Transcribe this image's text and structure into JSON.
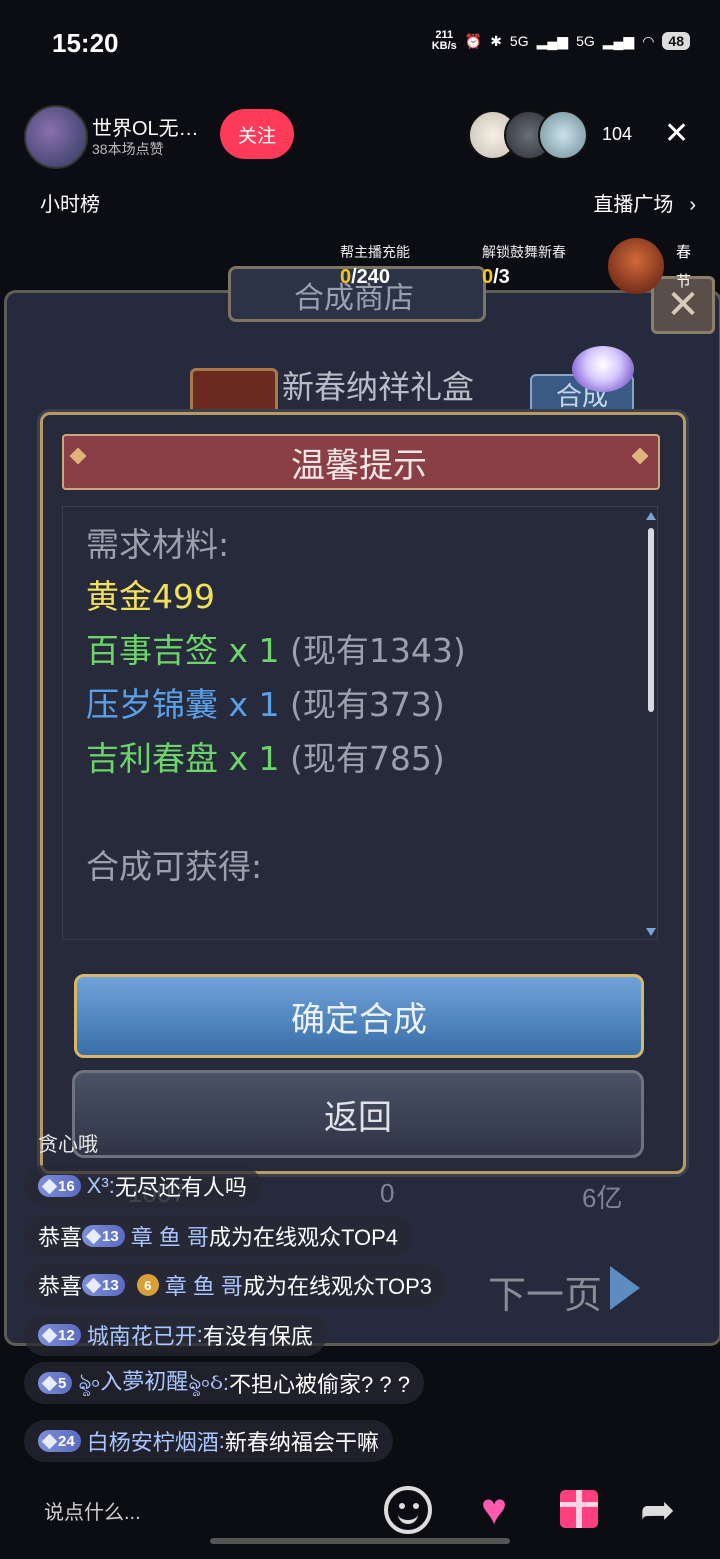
{
  "status_bar": {
    "time": "15:20",
    "net_speed_value": "211",
    "net_speed_unit": "KB/s",
    "signal_1": "5G",
    "signal_2": "5G",
    "battery": "48"
  },
  "header": {
    "host_name": "世界OL无…",
    "host_likes": "38本场点赞",
    "follow_label": "关注",
    "viewer_count": "104",
    "close_symbol": "✕"
  },
  "rank_bar": {
    "hour_rank": "小时榜",
    "live_square": "直播广场"
  },
  "tasks": [
    {
      "label": "帮主播充能",
      "current": "0",
      "total": "/240"
    },
    {
      "label": "解锁鼓舞新春",
      "current": "0",
      "total": "/3"
    }
  ],
  "spring_badge": {
    "line1": "春",
    "line2": "节"
  },
  "game": {
    "shop_title": "合成商店",
    "item_name": "新春纳祥礼盒",
    "synth_button": "合成",
    "next_page": "下一页",
    "bottom_values": [
      "1007",
      "0",
      "6亿"
    ],
    "dialog": {
      "title": "温馨提示",
      "need_label": "需求材料:",
      "materials": [
        {
          "name": "黄金499",
          "qty": "",
          "owned": "",
          "color": "#f0e05a"
        },
        {
          "name": "百事吉签",
          "qty": " x 1 ",
          "owned": "(现有1343)",
          "color": "#6dd46a"
        },
        {
          "name": "压岁锦囊",
          "qty": " x 1 ",
          "owned": "(现有373)",
          "color": "#5aa0e8"
        },
        {
          "name": "吉利春盘",
          "qty": " x 1 ",
          "owned": "(现有785)",
          "color": "#6dd46a"
        }
      ],
      "obtain_label": "合成可获得:",
      "confirm_label": "确定合成",
      "back_label": "返回"
    }
  },
  "chat": {
    "user_only": "贪心哦",
    "messages": [
      {
        "badge": "16",
        "user": "X³",
        "sep": ":",
        "text": "无尽还有人吗"
      },
      {
        "prefix": "恭喜",
        "badge": "13",
        "user": "章 鱼 哥",
        "text": "成为在线观众TOP4"
      },
      {
        "prefix": "恭喜",
        "badge": "13",
        "badge2": "6",
        "user": "章 鱼 哥",
        "text": "成为在线观众TOP3"
      },
      {
        "badge": "12",
        "user": "城南花已开",
        "sep": ":",
        "text": "有没有保底"
      },
      {
        "badge": "5",
        "user": "ৡ৹入夢初醒ৡ৹ઠ",
        "sep": ":",
        "text": "不担心被偷家? ? ?"
      },
      {
        "badge": "24",
        "user": "白杨安柠烟酒",
        "sep": ":",
        "text": "新春纳福会干嘛"
      }
    ]
  },
  "bottom_bar": {
    "input_placeholder": "说点什么..."
  },
  "colors": {
    "follow": "#fe3a59",
    "gold_text": "#f0e05a",
    "green_text": "#6dd46a",
    "blue_text": "#5aa0e8",
    "dialog_header": "#8a3e46"
  },
  "icons": [
    "alarm-icon",
    "bluetooth-icon",
    "wifi-icon",
    "close-icon",
    "chevron-right-icon",
    "emoji-icon",
    "heart-icon",
    "gift-icon",
    "share-icon"
  ]
}
